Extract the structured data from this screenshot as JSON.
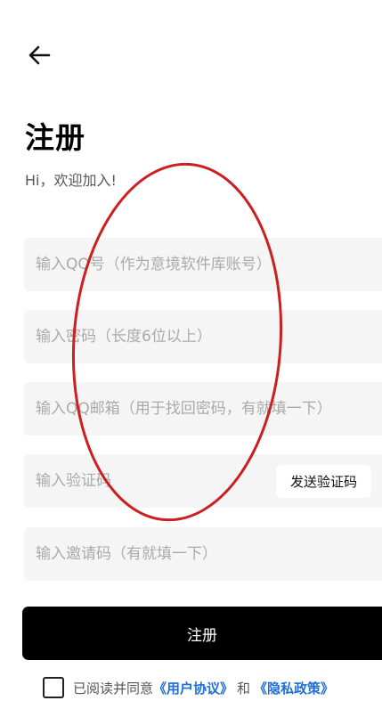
{
  "header": {
    "back_icon": "arrow-left-icon"
  },
  "title": "注册",
  "subtitle": "Hi，欢迎加入!",
  "form": {
    "qq_placeholder": "输入QQ号（作为意境软件库账号）",
    "password_placeholder": "输入密码（长度6位以上）",
    "email_placeholder": "输入QQ邮箱（用于找回密码，有就填一下）",
    "code_placeholder": "输入验证码",
    "send_code_label": "发送验证码",
    "invite_placeholder": "输入邀请码（有就填一下）"
  },
  "register_label": "注册",
  "agreement": {
    "prefix": "已阅读并同意",
    "user_agreement": "《用户协议》",
    "and": "和",
    "privacy_policy": "《隐私政策》"
  },
  "colors": {
    "link": "#1e6fd9",
    "button": "#000000",
    "field_bg": "#f5f5f5",
    "annotation": "#cc1f1f"
  }
}
